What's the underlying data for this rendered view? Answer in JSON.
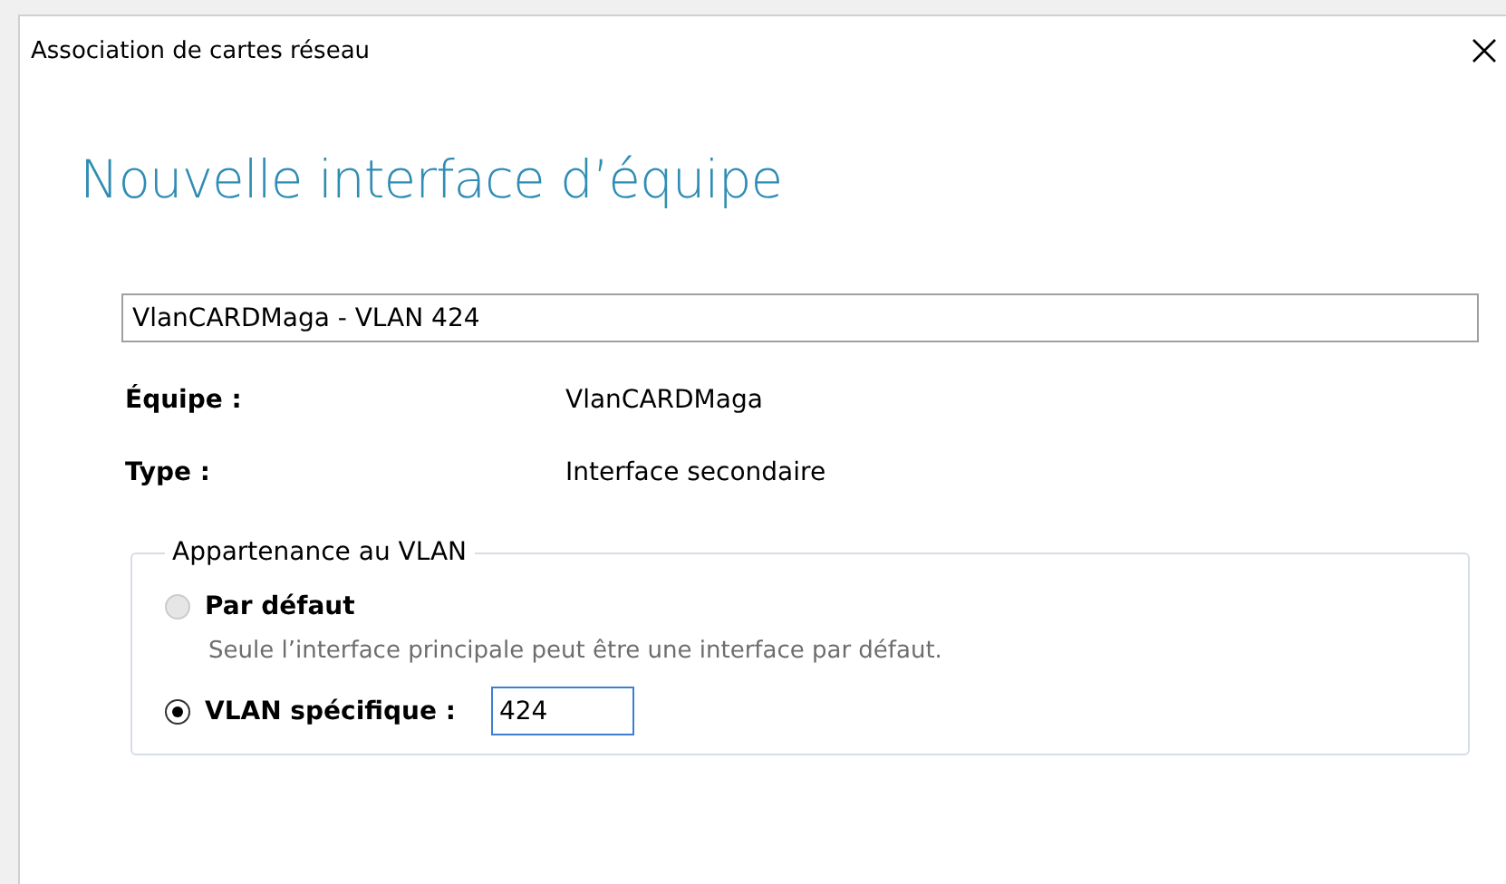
{
  "window": {
    "title": "Association de cartes réseau"
  },
  "heading": "Nouvelle interface d’équipe",
  "name_field": {
    "value": "VlanCARDMaga - VLAN 424"
  },
  "details": [
    {
      "label": "Équipe :",
      "value": "VlanCARDMaga"
    },
    {
      "label": "Type :",
      "value": "Interface secondaire"
    }
  ],
  "vlan_group": {
    "title": "Appartenance au VLAN",
    "options": [
      {
        "label": "Par défaut",
        "selected": false,
        "disabled": true,
        "note": "Seule l’interface principale peut être une interface par défaut."
      },
      {
        "label": "VLAN spécifique :",
        "selected": true,
        "disabled": false,
        "value": "424"
      }
    ]
  }
}
